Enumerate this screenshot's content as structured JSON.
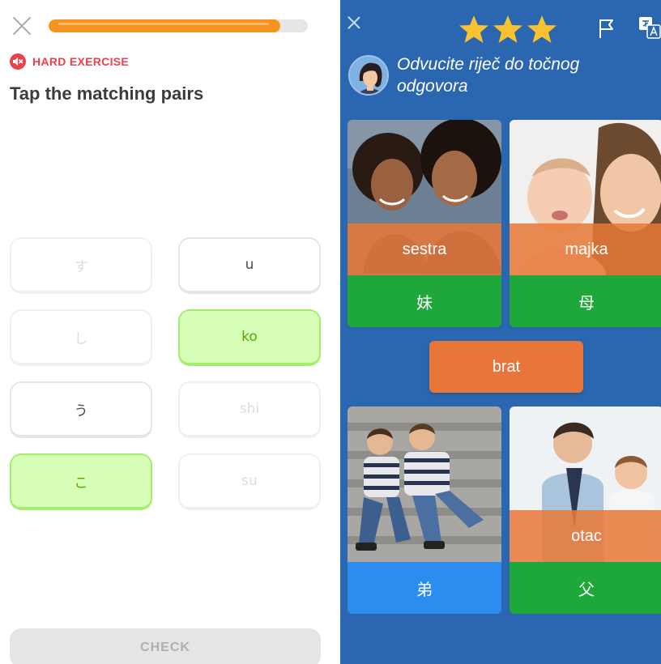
{
  "left": {
    "progress_fraction": 0.895,
    "progress_color": "#f7931e",
    "hard_exercise_label": "HARD EXERCISE",
    "hard_color": "#e8424a",
    "title": "Tap the matching pairs",
    "tiles": [
      {
        "text": "す",
        "state": "faded"
      },
      {
        "text": "u",
        "state": "normal"
      },
      {
        "text": "し",
        "state": "faded"
      },
      {
        "text": "ko",
        "state": "selected"
      },
      {
        "text": "う",
        "state": "normal"
      },
      {
        "text": "shi",
        "state": "faded"
      },
      {
        "text": "こ",
        "state": "selected"
      },
      {
        "text": "su",
        "state": "faded"
      }
    ],
    "check_label": "CHECK",
    "icons": [
      "close-icon",
      "muted-speaker-icon"
    ]
  },
  "right": {
    "background_color": "#2b67b0",
    "star_count": 3,
    "instruction": "Odvucite riječ do točnog odgovora",
    "cards": [
      {
        "word": "sestra",
        "answer": "妹",
        "answer_color": "green"
      },
      {
        "word": "majka",
        "answer": "母",
        "answer_color": "green"
      },
      {
        "word": "",
        "answer": "弟",
        "answer_color": "blue"
      },
      {
        "word": "otac",
        "answer": "父",
        "answer_color": "green"
      }
    ],
    "draggable_word": "brat",
    "icons": [
      "close-icon",
      "star-icon",
      "flag-icon",
      "translate-icon",
      "avatar"
    ]
  }
}
